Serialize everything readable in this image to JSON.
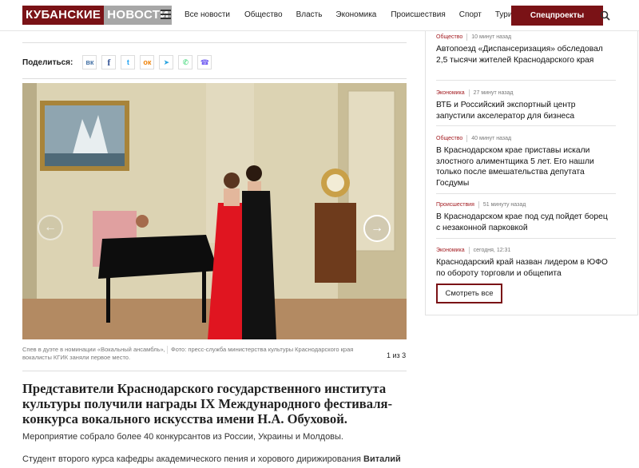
{
  "header": {
    "logo_part1": "КУБАНСКИЕ",
    "logo_part2": "НОВОСТИ",
    "nav": [
      {
        "label": "Все новости"
      },
      {
        "label": "Общество"
      },
      {
        "label": "Власть"
      },
      {
        "label": "Экономика"
      },
      {
        "label": "Происшествия"
      },
      {
        "label": "Спорт"
      },
      {
        "label": "Туризм"
      }
    ],
    "special_label": "Спецпроекты",
    "colors": {
      "brand": "#7a1216",
      "logo_gray": "#a7a7a7"
    }
  },
  "share": {
    "label": "Поделиться:",
    "buttons": [
      {
        "icon": "vk-icon",
        "glyph": "вк",
        "color": "#4a76a8"
      },
      {
        "icon": "facebook-icon",
        "glyph": "f",
        "color": "#3b5998"
      },
      {
        "icon": "twitter-icon",
        "glyph": "t",
        "color": "#1da1f2"
      },
      {
        "icon": "odnoklassniki-icon",
        "glyph": "ок",
        "color": "#ee8208"
      },
      {
        "icon": "telegram-icon",
        "glyph": "➤",
        "color": "#2ca5e0"
      },
      {
        "icon": "whatsapp-icon",
        "glyph": "✆",
        "color": "#25d366"
      },
      {
        "icon": "viber-icon",
        "glyph": "☎",
        "color": "#7360f2"
      }
    ]
  },
  "gallery": {
    "caption": "Спев в дуэте в номинации «Вокальный ансамбль», вокалисты КГИК заняли первое место.",
    "credit": "Фото: пресс-служба министерства культуры Краснодарского края",
    "counter": "1 из 3"
  },
  "article": {
    "headline": "Представители Краснодарского государственного института культуры получили награды IX Международного фестиваля-конкурса вокального искусства имени Н.А. Обуховой.",
    "lead": "Мероприятие собрало более 40 конкурсантов из России, Украины и Молдовы.",
    "para_start": "Студент второго курса кафедры академического пения и хорового дирижирования ",
    "para_bold": "Виталий"
  },
  "sidebar": {
    "news": [
      {
        "category": "Общество",
        "time": "10 минут назад",
        "title": "Автопоезд «Диспансеризация» обследовал 2,5 тысячи жителей Краснодарского края"
      },
      {
        "category": "Экономика",
        "time": "27 минут назад",
        "title": "ВТБ и Российский экспортный центр запустили акселератор для бизнеса"
      },
      {
        "category": "Общество",
        "time": "40 минут назад",
        "title": "В Краснодарском крае приставы искали злостного алиментщика 5 лет. Его нашли только после вмешательства депутата Госдумы"
      },
      {
        "category": "Происшествия",
        "time": "51 минуту назад",
        "title": "В Краснодарском крае под суд пойдет борец с незаконной парковкой"
      },
      {
        "category": "Экономика",
        "time": "сегодня, 12:31",
        "title": "Краснодарский край назван лидером в ЮФО по обороту торговли и общепита"
      }
    ],
    "more_label": "Смотреть все"
  }
}
